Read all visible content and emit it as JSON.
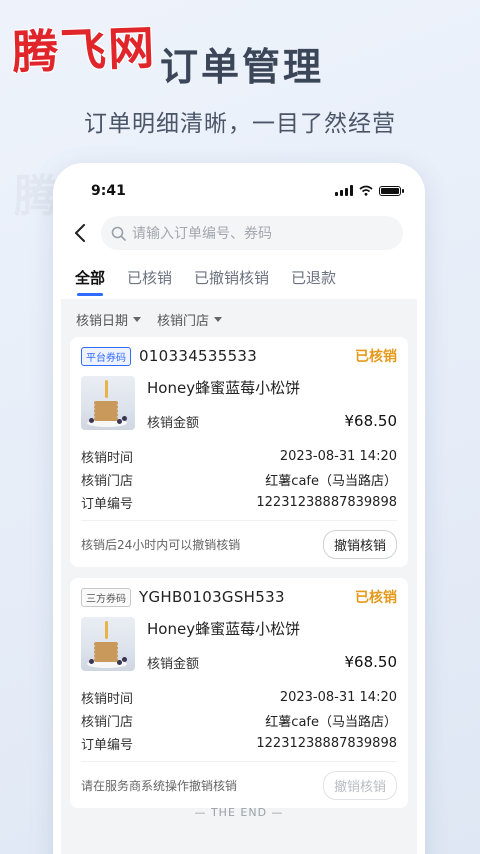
{
  "promo": {
    "logo": "腾飞网",
    "title": "订单管理",
    "subtitle": "订单明细清晰，一目了然经营",
    "watermark": "腾飞网"
  },
  "status_bar": {
    "time": "9:41"
  },
  "search": {
    "placeholder": "请输入订单编号、券码"
  },
  "tabs": [
    {
      "label": "全部",
      "active": true
    },
    {
      "label": "已核销",
      "active": false
    },
    {
      "label": "已撤销核销",
      "active": false
    },
    {
      "label": "已退款",
      "active": false
    }
  ],
  "filters": [
    {
      "label": "核销日期"
    },
    {
      "label": "核销门店"
    }
  ],
  "orders": [
    {
      "badge": "平台券码",
      "code": "010334535533",
      "status": "已核销",
      "product_name": "Honey蜂蜜蓝莓小松饼",
      "amount_label": "核销金额",
      "amount": "¥68.50",
      "details": [
        {
          "label": "核销时间",
          "value": "2023-08-31 14:20"
        },
        {
          "label": "核销门店",
          "value": "红薯cafe（马当路店）"
        },
        {
          "label": "订单编号",
          "value": "12231238887839898"
        }
      ],
      "footer_note": "核销后24小时内可以撤销核销",
      "action": "撤销核销"
    },
    {
      "badge": "三方券码",
      "code": "YGHB0103GSH533",
      "status": "已核销",
      "product_name": "Honey蜂蜜蓝莓小松饼",
      "amount_label": "核销金额",
      "amount": "¥68.50",
      "details": [
        {
          "label": "核销时间",
          "value": "2023-08-31 14:20"
        },
        {
          "label": "核销门店",
          "value": "红薯cafe（马当路店）"
        },
        {
          "label": "订单编号",
          "value": "12231238887839898"
        }
      ],
      "footer_note": "请在服务商系统操作撤销核销",
      "action": "撤销核销"
    }
  ],
  "end_text": "— THE END —",
  "colors": {
    "accent": "#2f6bff",
    "status": "#e59a1c",
    "logo": "#e0262b"
  }
}
